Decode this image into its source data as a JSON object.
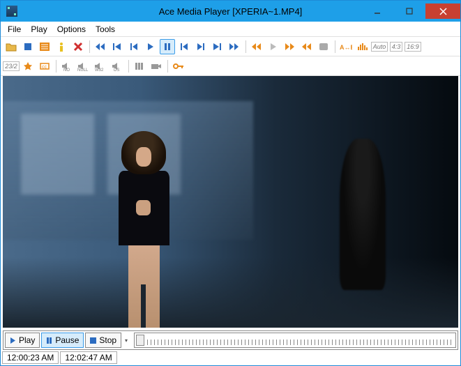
{
  "title": "Ace Media Player [XPERIA~1.MP4]",
  "menu": {
    "file": "File",
    "play": "Play",
    "options": "Options",
    "tools": "Tools"
  },
  "toolbar1": {
    "open": "open",
    "stop": "stop",
    "list": "list",
    "info": "info",
    "close": "close",
    "rewind": "rewind",
    "prev": "prev",
    "stepback": "stepback",
    "play": "play",
    "pause": "pause",
    "stepfwd": "stepfwd",
    "next": "next",
    "ffwd": "ffwd",
    "speed": "speed",
    "skipback": "skipback",
    "playdim": "playdim",
    "skipfwd": "skipfwd",
    "slow": "slow",
    "snapshot": "snapshot",
    "ab": "ab",
    "eq": "eq",
    "aspect_auto": "Auto",
    "aspect_43": "4:3",
    "aspect_169": "16:9"
  },
  "toolbar2": {
    "ratio": "23/2",
    "fav": "fav",
    "caption": "caption",
    "audio_no": "NO",
    "audio_null": "NULL",
    "audio_w32": "W32",
    "audio_ds": "DS",
    "filters": "filters",
    "cam": "cam",
    "key": "key"
  },
  "controls": {
    "play": "Play",
    "pause": "Pause",
    "stop": "Stop"
  },
  "status": {
    "elapsed": "12:00:23 AM",
    "total": "12:02:47 AM"
  },
  "colors": {
    "accent": "#1e9fe8",
    "close": "#c84031",
    "blue_icon": "#2c6cc0",
    "orange_icon": "#e88a1a",
    "red_icon": "#d03030",
    "yellow_icon": "#e8c020",
    "gray_icon": "#999"
  }
}
